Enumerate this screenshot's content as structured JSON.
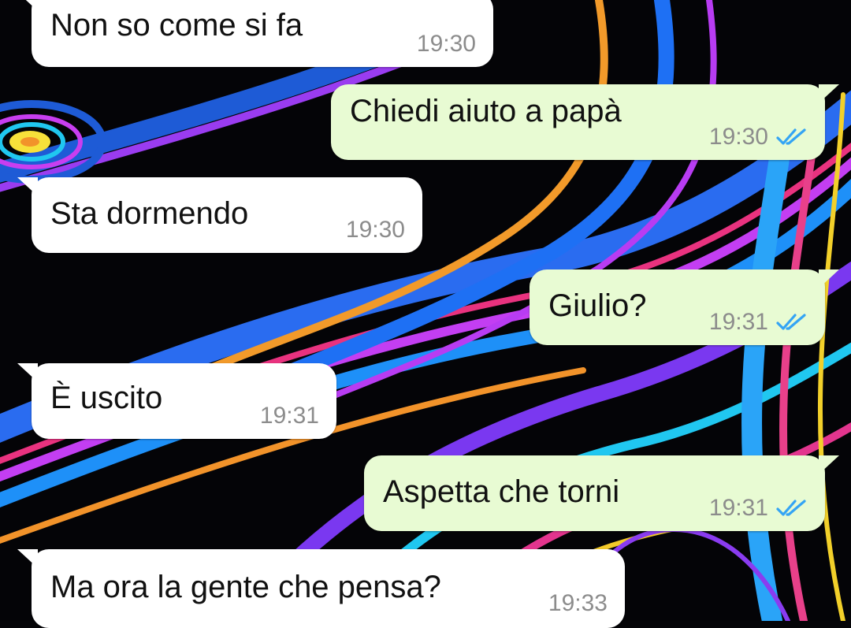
{
  "theme": {
    "incoming_bubble_color": "#ffffff",
    "outgoing_bubble_color": "#e8fbd3",
    "read_tick_color": "#34a4f4"
  },
  "messages": [
    {
      "direction": "incoming",
      "text": "Non so come si fa",
      "time": "19:30"
    },
    {
      "direction": "outgoing",
      "text": "Chiedi aiuto a papà",
      "time": "19:30",
      "status": "read-double-check-icon"
    },
    {
      "direction": "incoming",
      "text": "Sta dormendo",
      "time": "19:30"
    },
    {
      "direction": "outgoing",
      "text": "Giulio?",
      "time": "19:31",
      "status": "read-double-check-icon"
    },
    {
      "direction": "incoming",
      "text": "È uscito",
      "time": "19:31"
    },
    {
      "direction": "outgoing",
      "text": "Aspetta che torni",
      "time": "19:31",
      "status": "read-double-check-icon"
    },
    {
      "direction": "incoming",
      "text": "Ma ora la gente che pensa?",
      "time": "19:33"
    }
  ]
}
